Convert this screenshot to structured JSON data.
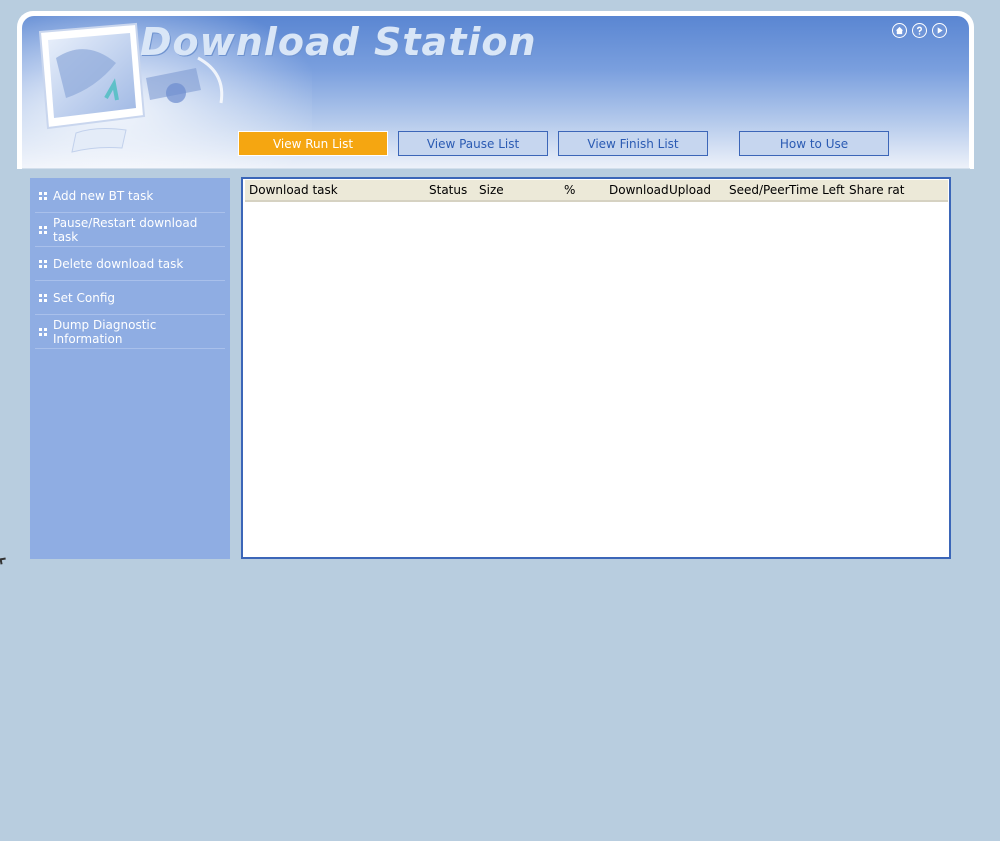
{
  "app": {
    "title": "Download Station"
  },
  "top_icons": [
    "home-icon",
    "help-icon",
    "play-icon"
  ],
  "nav": {
    "buttons": [
      {
        "label": "View Run List",
        "active": true
      },
      {
        "label": "View Pause List",
        "active": false
      },
      {
        "label": "View Finish List",
        "active": false
      },
      {
        "label": "How to Use",
        "active": false
      }
    ]
  },
  "sidebar": {
    "items": [
      {
        "label": "Add new BT task"
      },
      {
        "label": "Pause/Restart download task"
      },
      {
        "label": "Delete download task"
      },
      {
        "label": "Set Config"
      },
      {
        "label": "Dump Diagnostic Information"
      }
    ]
  },
  "table": {
    "columns": [
      "Download task",
      "Status",
      "Size",
      "%",
      "Download",
      "Upload",
      "Seed/Peer",
      "Time Left",
      "Share rat"
    ],
    "rows": []
  },
  "colors": {
    "background": "#b8cddf",
    "accent": "#f5a611",
    "button_border": "#3c66b8",
    "sidebar": "#8fade3"
  }
}
